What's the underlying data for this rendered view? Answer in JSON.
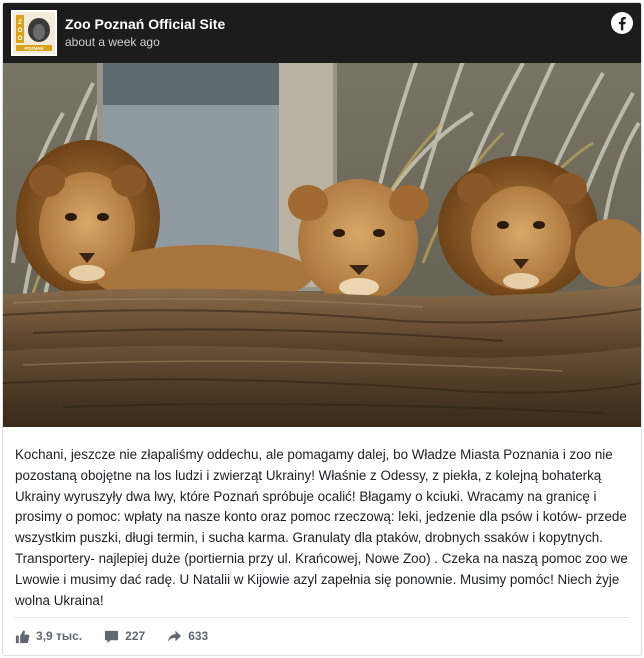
{
  "page": {
    "name": "Zoo Poznań Official Site",
    "timestamp": "about a week ago",
    "avatar_text": "ZOO POZNAŃ"
  },
  "post": {
    "text": "Kochani, jeszcze nie złapaliśmy oddechu, ale pomagamy dalej, bo Władze Miasta Poznania i zoo nie pozostaną obojętne na los ludzi i zwierząt Ukrainy! Właśnie z Odessy, z piekła, z kolejną bohaterką Ukrainy wyruszyły dwa lwy, które Poznań spróbuje ocalić! Błagamy o kciuki. Wracamy na granicę i prosimy o pomoc: wpłaty na nasze konto oraz pomoc rzeczową: leki, jedzenie dla psów i kotów- przede wszystkim puszki, długi termin, i sucha karma. Granulaty dla ptaków, drobnych ssaków i kopytnych. Transportery- najlepiej duże (portiernia przy ul. Krańcowej, Nowe Zoo) . Czeka na naszą pomoc zoo we Lwowie i musimy dać radę. U Natalii w Kijowie azyl zapełnia się ponownie. Musimy pomóc! Niech żyje wolna Ukraina!"
  },
  "stats": {
    "likes": "3,9 тыс.",
    "comments": "227",
    "shares": "633"
  },
  "icons": {
    "facebook": "facebook-icon",
    "like": "thumbs-up-icon",
    "comment": "comment-icon",
    "share": "share-icon"
  },
  "colors": {
    "facebook_blue": "#1877f2",
    "meta_text": "#606770"
  }
}
